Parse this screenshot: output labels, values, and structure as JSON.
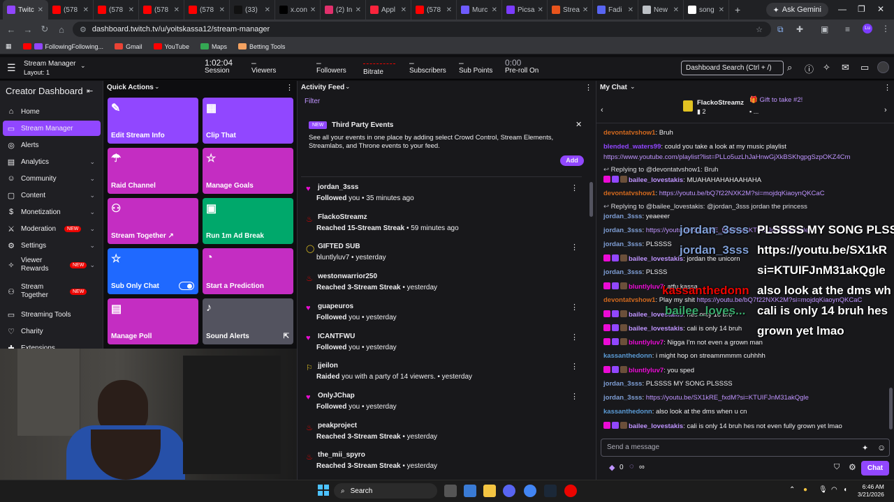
{
  "browser": {
    "tabs": [
      {
        "label": "Twitc",
        "color": "#9146ff",
        "active": true
      },
      {
        "label": "(578",
        "color": "#ff0000"
      },
      {
        "label": "(578",
        "color": "#ff0000"
      },
      {
        "label": "(578",
        "color": "#ff0000"
      },
      {
        "label": "(578",
        "color": "#ff0000"
      },
      {
        "label": "(33)",
        "color": "#111111"
      },
      {
        "label": "x.con",
        "color": "#000000"
      },
      {
        "label": "(2) In",
        "color": "#e1306c"
      },
      {
        "label": "Appl",
        "color": "#fa243c"
      },
      {
        "label": "(578",
        "color": "#ff0000"
      },
      {
        "label": "Murc",
        "color": "#6e5bff"
      },
      {
        "label": "Picsa",
        "color": "#7b3cff"
      },
      {
        "label": "Strea",
        "color": "#e8541c"
      },
      {
        "label": "Fadi",
        "color": "#5865f2"
      },
      {
        "label": "New",
        "color": "#bdc1c6"
      },
      {
        "label": "song",
        "color": "#ffffff"
      }
    ],
    "ask_gemini": "Ask Gemini",
    "url": "dashboard.twitch.tv/u/yoitskassa12/stream-manager",
    "bookmarks": [
      "FollowingFollowing...",
      "Gmail",
      "YouTube",
      "Maps",
      "Betting Tools"
    ]
  },
  "topbar": {
    "title": "Stream Manager",
    "layout": "Layout: 1",
    "session_value": "1:02:04",
    "session_label": "Session",
    "viewers_value": "–",
    "viewers_label": "Viewers",
    "followers_value": "–",
    "followers_label": "Followers",
    "bitrate_label": "Bitrate",
    "subscribers_value": "–",
    "subscribers_label": "Subscribers",
    "subpoints_value": "–",
    "subpoints_label": "Sub Points",
    "preroll_value": "0:00",
    "preroll_label": "Pre-roll On",
    "search_placeholder": "Dashboard Search (Ctrl + /)"
  },
  "sidebar": {
    "title": "Creator Dashboard",
    "items": [
      {
        "label": "Home",
        "icon": "home-icon"
      },
      {
        "label": "Stream Manager",
        "icon": "stream-manager-icon",
        "selected": true
      },
      {
        "label": "Alerts",
        "icon": "alerts-icon"
      },
      {
        "label": "Analytics",
        "icon": "analytics-icon",
        "chevron": true
      },
      {
        "label": "Community",
        "icon": "community-icon",
        "chevron": true
      },
      {
        "label": "Content",
        "icon": "content-icon",
        "chevron": true
      },
      {
        "label": "Monetization",
        "icon": "monetization-icon",
        "chevron": true
      },
      {
        "label": "Moderation",
        "icon": "moderation-icon",
        "badge": "NEW",
        "chevron": true
      },
      {
        "label": "Settings",
        "icon": "settings-icon",
        "chevron": true
      },
      {
        "label": "Viewer Rewards",
        "icon": "viewer-rewards-icon",
        "badge": "NEW",
        "chevron": true
      },
      {
        "label": "Stream Together",
        "icon": "stream-together-icon",
        "badge": "NEW"
      },
      {
        "label": "Streaming Tools",
        "icon": "streaming-tools-icon"
      },
      {
        "label": "Charity",
        "icon": "charity-icon"
      },
      {
        "label": "Extensions",
        "icon": "extensions-icon"
      }
    ]
  },
  "quick_actions": {
    "header": "Quick Actions",
    "tiles": [
      {
        "label": "Edit Stream Info",
        "color": "#9147ff",
        "icon": "pencil-icon"
      },
      {
        "label": "Clip That",
        "color": "#9147ff",
        "icon": "clip-icon"
      },
      {
        "label": "Raid Channel",
        "color": "#c42dc2",
        "icon": "raid-icon"
      },
      {
        "label": "Manage Goals",
        "color": "#c42dc2",
        "icon": "star-icon"
      },
      {
        "label": "Stream Together ↗",
        "color": "#c42dc2",
        "icon": "add-user-icon"
      },
      {
        "label": "Run 1m Ad Break",
        "color": "#00a86b",
        "icon": "ad-icon"
      },
      {
        "label": "Sub Only Chat",
        "color": "#1f69ff",
        "icon": "star-icon",
        "toggle": true
      },
      {
        "label": "Start a Prediction",
        "color": "#c42dc2",
        "icon": "prediction-icon"
      },
      {
        "label": "Manage Poll",
        "color": "#c42dc2",
        "icon": "poll-icon"
      },
      {
        "label": "Sound Alerts",
        "color": "#53535f",
        "icon": "sound-alerts-icon"
      }
    ]
  },
  "activity": {
    "header": "Activity Feed",
    "filter": "Filter",
    "promo_badge": "NEW",
    "promo_title": "Third Party Events",
    "promo_text": "See all your events in one place by adding select Crowd Control, Stream Elements, Streamlabs, and Throne events to your feed.",
    "promo_button": "Add",
    "events": [
      {
        "name": "jordan_3sss",
        "action": "Followed",
        "detail": " you • 35 minutes ago",
        "icon": "heart-icon",
        "color": "#eb0bd5"
      },
      {
        "name": "FlackoStreamz",
        "action": "Reached ",
        "detail": "15-Stream Streak",
        "time": " • 59 minutes ago",
        "icon": "flame-icon",
        "color": "#eb0400"
      },
      {
        "name": "GIFTED SUB",
        "action": "bluntlyluv7",
        "detail": " • yesterday",
        "icon": "gift-icon",
        "color": "#e1c222"
      },
      {
        "name": "westonwarrior250",
        "action": "Reached ",
        "detail": "3-Stream Streak",
        "time": " • yesterday",
        "icon": "flame-icon",
        "color": "#eb0400"
      },
      {
        "name": "guapeuros",
        "action": "Followed",
        "detail": " you • yesterday",
        "icon": "heart-icon",
        "color": "#eb0bd5"
      },
      {
        "name": "ICANTFWU",
        "action": "Followed",
        "detail": " you • yesterday",
        "icon": "heart-icon",
        "color": "#eb0bd5"
      },
      {
        "name": "jjeilon",
        "action": "Raided",
        "detail": " you with a party of 14 viewers. • yesterday",
        "icon": "raid-icon",
        "color": "#e1c222"
      },
      {
        "name": "OnlyJChap",
        "action": "Followed",
        "detail": " you • yesterday",
        "icon": "heart-icon",
        "color": "#eb0bd5"
      },
      {
        "name": "peakproject",
        "action": "Reached ",
        "detail": "3-Stream Streak",
        "time": " • yesterday",
        "icon": "flame-icon",
        "color": "#eb0400"
      },
      {
        "name": "the_mii_spyro",
        "action": "Reached ",
        "detail": "3-Stream Streak",
        "time": " • yesterday",
        "icon": "flame-icon",
        "color": "#eb0400"
      }
    ]
  },
  "chat": {
    "header": "My Chat",
    "gift_user": "FlackoStreamz",
    "gift_count": "2",
    "gift_text": "Gift to take #2!",
    "gift_more": "...",
    "input_placeholder": "Send a message",
    "points": "0",
    "infinity": "∞",
    "chat_button": "Chat",
    "overlay_name1": "jordan_3sss",
    "overlay_name2": "jordan_3sss",
    "overlay_name3": "kassanthedonn",
    "overlay_name4": "bailee_loves...",
    "overlay_l1": "PLSSSS MY SONG PLSS",
    "overlay_l2": "https://youtu.be/SX1kR",
    "overlay_l3": "si=KTUIFJnM31akQgle",
    "overlay_l4": "also look at the dms wh",
    "overlay_l5": "cali is only 14 bruh hes",
    "overlay_l6": "grown yet lmao"
  },
  "taskbar": {
    "search": "Search",
    "time": "6:46 AM",
    "date": "3/21/2026"
  }
}
